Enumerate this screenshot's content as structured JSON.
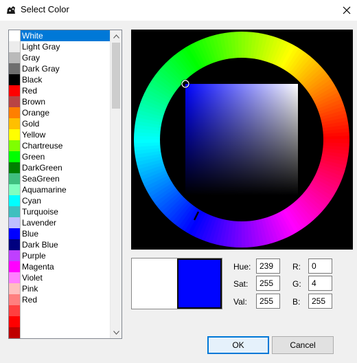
{
  "window": {
    "title": "Select Color",
    "app_icon": "rhino-icon",
    "close_icon": "close-icon"
  },
  "color_list": {
    "selected": "White",
    "items": [
      {
        "label": "White",
        "color": "#ffffff"
      },
      {
        "label": "Light Gray",
        "color": "#ececec"
      },
      {
        "label": "Gray",
        "color": "#bababa"
      },
      {
        "label": "Dark Gray",
        "color": "#6e6e6e"
      },
      {
        "label": "Black",
        "color": "#000000"
      },
      {
        "label": "Red",
        "color": "#ff0000"
      },
      {
        "label": "Brown",
        "color": "#b94444"
      },
      {
        "label": "Orange",
        "color": "#ff7f00"
      },
      {
        "label": "Gold",
        "color": "#ffbf00"
      },
      {
        "label": "Yellow",
        "color": "#ffff00"
      },
      {
        "label": "Chartreuse",
        "color": "#7fff00"
      },
      {
        "label": "Green",
        "color": "#00ff00"
      },
      {
        "label": "DarkGreen",
        "color": "#007f00"
      },
      {
        "label": "SeaGreen",
        "color": "#3fbf7f"
      },
      {
        "label": "Aquamarine",
        "color": "#7fffbf"
      },
      {
        "label": "Cyan",
        "color": "#00ffff"
      },
      {
        "label": "Turquoise",
        "color": "#3fbfbf"
      },
      {
        "label": "Lavender",
        "color": "#bfbfff"
      },
      {
        "label": "Blue",
        "color": "#0000ff"
      },
      {
        "label": "Dark Blue",
        "color": "#00007f"
      },
      {
        "label": "Purple",
        "color": "#bf3fff"
      },
      {
        "label": "Magenta",
        "color": "#ff00ff"
      },
      {
        "label": "Violet",
        "color": "#ff7fff"
      },
      {
        "label": "Pink",
        "color": "#ffbfbf"
      },
      {
        "label": "Red",
        "color": "#ff7f7f"
      }
    ],
    "extra_swatches": [
      "#ff3f3f",
      "#ff0000",
      "#bf0000"
    ]
  },
  "wheel": {
    "hue": 239,
    "saturation": 255,
    "value": 255
  },
  "preview": {
    "old_color": "#ffffff",
    "new_color": "#0004ff"
  },
  "fields": {
    "hue_label": "Hue:",
    "hue_value": "239",
    "sat_label": "Sat:",
    "sat_value": "255",
    "val_label": "Val:",
    "val_value": "255",
    "r_label": "R:",
    "r_value": "0",
    "g_label": "G:",
    "g_value": "4",
    "b_label": "B:",
    "b_value": "255"
  },
  "buttons": {
    "ok_label": "OK",
    "cancel_label": "Cancel"
  }
}
